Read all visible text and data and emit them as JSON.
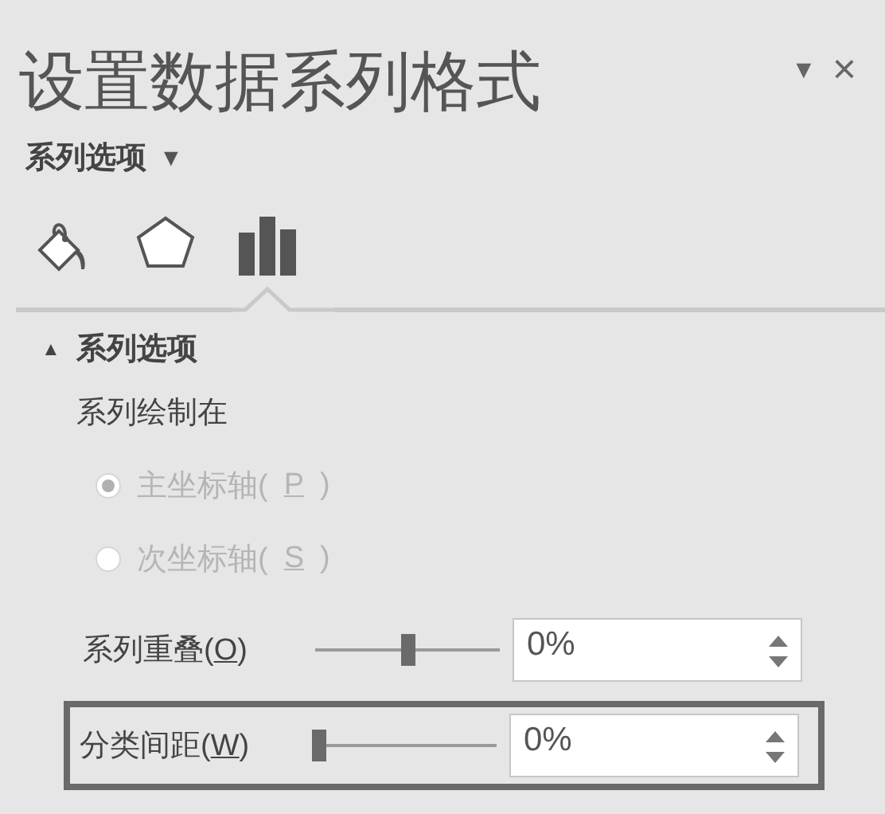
{
  "pane": {
    "title": "设置数据系列格式",
    "menu_glyph": "▼",
    "close_glyph": "×"
  },
  "options_menu": {
    "label": "系列选项",
    "caret": "▼"
  },
  "tabs": [
    {
      "kind": "fill",
      "selected": false
    },
    {
      "kind": "effects",
      "selected": false
    },
    {
      "kind": "series",
      "selected": true
    }
  ],
  "section": {
    "toggle": "▲",
    "title": "系列选项",
    "expanded": true
  },
  "plot_on_label": "系列绘制在",
  "radios": [
    {
      "label_before": "主坐标轴(",
      "access_key": "P",
      "label_after": ")",
      "selected": true,
      "disabled": true
    },
    {
      "label_before": "次坐标轴(",
      "access_key": "S",
      "label_after": ")",
      "selected": false,
      "disabled": true
    }
  ],
  "sliders": [
    {
      "label_before": "系列重叠(",
      "access_key": "O",
      "label_after": ")",
      "level": 0.5,
      "value": "0%",
      "highlighted": false
    },
    {
      "label_before": "分类间距(",
      "access_key": "W",
      "label_after": ")",
      "level": 0.0,
      "value": "0%",
      "highlighted": true
    }
  ]
}
